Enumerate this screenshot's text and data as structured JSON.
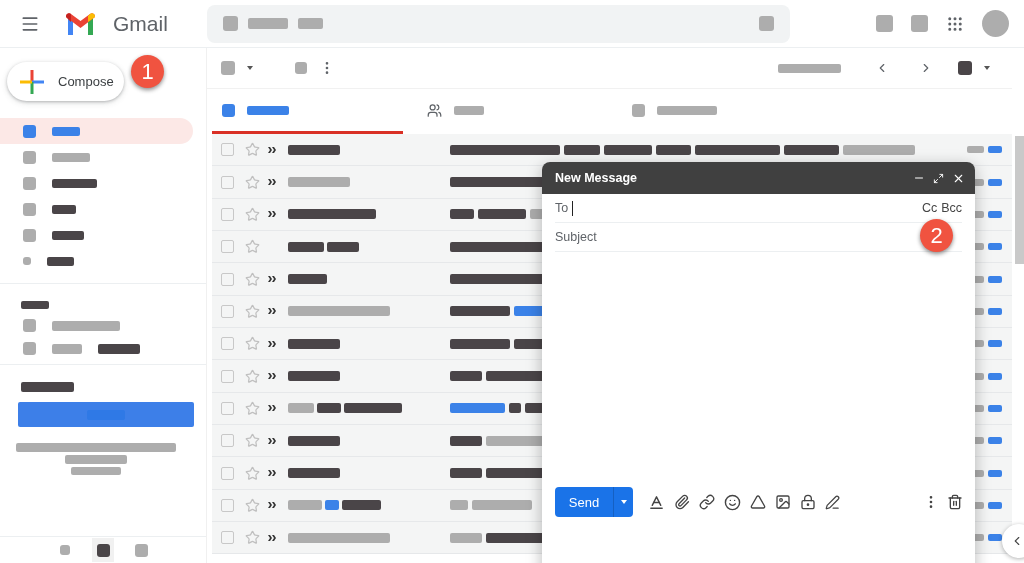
{
  "header": {
    "app_name": "Gmail"
  },
  "compose_button": {
    "label": "Compose"
  },
  "toolbar": {
    "select_all_checked": false
  },
  "callouts": [
    {
      "number": "1"
    },
    {
      "number": "2"
    }
  ],
  "sidebar": {
    "items": [
      {
        "selected": true
      },
      {
        "selected": false
      },
      {
        "selected": false
      },
      {
        "selected": false
      },
      {
        "selected": false
      },
      {
        "selected": false
      }
    ]
  },
  "tabs": [
    {
      "selected": true
    },
    {
      "selected": false
    },
    {
      "selected": false
    }
  ],
  "emails": [
    {
      "checked": false,
      "starred": false,
      "important": true
    },
    {
      "checked": false,
      "starred": false,
      "important": true
    },
    {
      "checked": false,
      "starred": false,
      "important": true
    },
    {
      "checked": false,
      "starred": false,
      "important": false
    },
    {
      "checked": false,
      "starred": false,
      "important": true
    },
    {
      "checked": false,
      "starred": false,
      "important": true
    },
    {
      "checked": false,
      "starred": false,
      "important": true
    },
    {
      "checked": false,
      "starred": false,
      "important": true
    },
    {
      "checked": false,
      "starred": false,
      "important": true
    },
    {
      "checked": false,
      "starred": false,
      "important": true
    },
    {
      "checked": false,
      "starred": false,
      "important": true
    },
    {
      "checked": false,
      "starred": false,
      "important": true
    },
    {
      "checked": false,
      "starred": false,
      "important": true
    }
  ],
  "compose_window": {
    "title": "New Message",
    "to_label": "To",
    "cc_label": "Cc",
    "bcc_label": "Bcc",
    "subject_placeholder": "Subject",
    "send_label": "Send"
  }
}
